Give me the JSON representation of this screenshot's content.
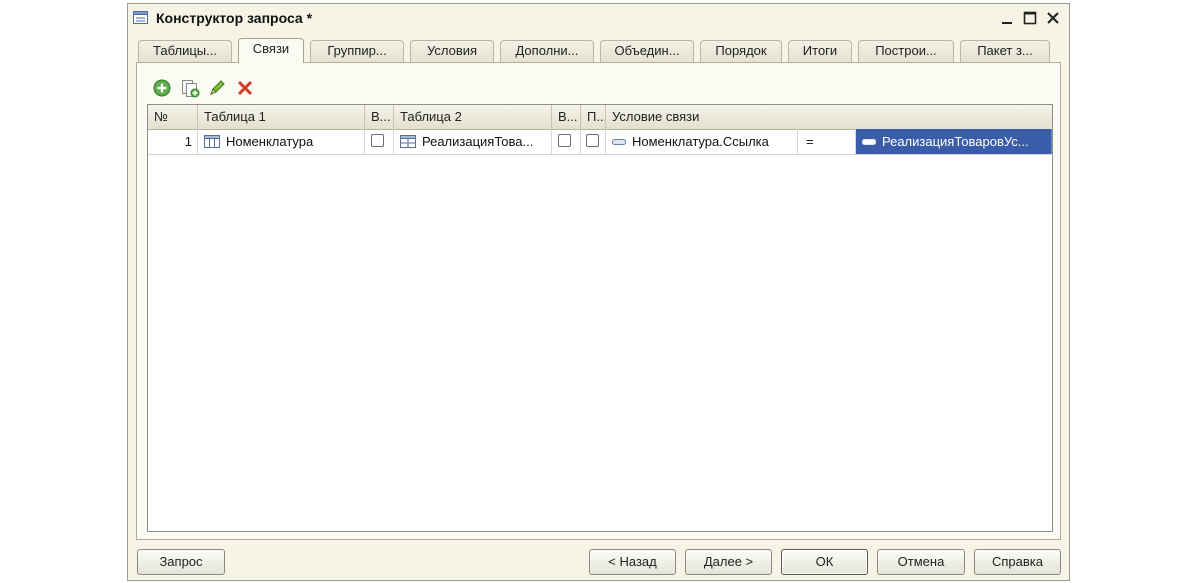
{
  "window": {
    "title": "Конструктор запроса *"
  },
  "tabs": [
    {
      "label": "Таблицы...",
      "active": false
    },
    {
      "label": "Связи",
      "active": true
    },
    {
      "label": "Группир...",
      "active": false
    },
    {
      "label": "Условия",
      "active": false
    },
    {
      "label": "Дополни...",
      "active": false
    },
    {
      "label": "Объедин...",
      "active": false
    },
    {
      "label": "Порядок",
      "active": false
    },
    {
      "label": "Итоги",
      "active": false
    },
    {
      "label": "Построи...",
      "active": false
    },
    {
      "label": "Пакет з...",
      "active": false
    }
  ],
  "toolbar": {
    "icons": [
      "add-icon",
      "copy-icon",
      "edit-icon",
      "delete-icon"
    ]
  },
  "grid": {
    "columns": [
      "№",
      "Таблица 1",
      "В...",
      "Таблица 2",
      "В...",
      "П...",
      "Условие связи"
    ],
    "rows": [
      {
        "num": "1",
        "table1": "Номенклатура",
        "all1": false,
        "table2": "РеализацияТова...",
        "all2": false,
        "arbitrary": false,
        "left_field": "Номенклатура.Ссылка",
        "operator": "=",
        "right_field": "РеализацияТоваровУс..."
      }
    ]
  },
  "buttons": {
    "query": "Запрос",
    "back": "< Назад",
    "next": "Далее >",
    "ok": "ОК",
    "cancel": "Отмена",
    "help": "Справка"
  },
  "colors": {
    "selection": "#3b5ca8",
    "window_bg": "#f5f4e6"
  }
}
